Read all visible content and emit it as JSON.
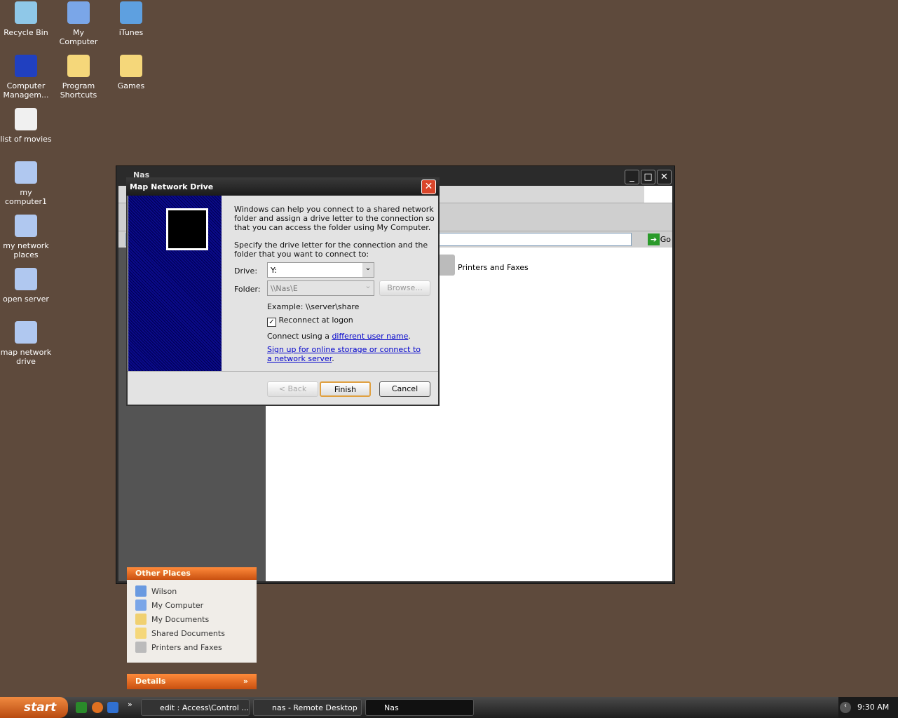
{
  "desktop": {
    "icons": [
      {
        "label": "Recycle Bin",
        "icon": "recycle-bin-icon",
        "color": "#8fc8e8"
      },
      {
        "label": "My Computer",
        "icon": "my-computer-icon",
        "color": "#7aa6e8"
      },
      {
        "label": "iTunes",
        "icon": "itunes-icon",
        "color": "#5ea0e0"
      },
      {
        "label": "Computer Managem...",
        "icon": "computer-management-icon",
        "color": "#2040c0"
      },
      {
        "label": "Program Shortcuts",
        "icon": "folder-icon",
        "color": "#f5d77a"
      },
      {
        "label": "Games",
        "icon": "folder-icon",
        "color": "#f5d77a"
      },
      {
        "label": "list of movies",
        "icon": "notepad-icon",
        "color": "#f0f0f0"
      },
      {
        "label": "my computer1",
        "icon": "shortcut-icon",
        "color": "#b0c8f0"
      },
      {
        "label": "my network places",
        "icon": "shortcut-icon",
        "color": "#b0c8f0"
      },
      {
        "label": "open server",
        "icon": "shortcut-icon",
        "color": "#b0c8f0"
      },
      {
        "label": "map network drive",
        "icon": "shortcut-icon",
        "color": "#b0c8f0"
      }
    ]
  },
  "explorer": {
    "title": "Nas",
    "go_label": "Go",
    "content_item": "Printers and Faxes",
    "other_places": {
      "title": "Other Places",
      "items": [
        "Wilson",
        "My Computer",
        "My Documents",
        "Shared Documents",
        "Printers and Faxes"
      ]
    },
    "details_title": "Details"
  },
  "dialog": {
    "title": "Map Network Drive",
    "intro": "Windows can help you connect to a shared network folder and assign a drive letter to the connection so that you can access the folder using My Computer.",
    "specify": "Specify the drive letter for the connection and the folder that you want to connect to:",
    "drive_label": "Drive:",
    "drive_value": "Y:",
    "folder_label": "Folder:",
    "folder_value": "\\\\Nas\\E",
    "browse": "Browse...",
    "example": "Example: \\\\server\\share",
    "reconnect": "Reconnect at logon",
    "reconnect_checked": true,
    "connect_prefix": "Connect using a ",
    "connect_link": "different user name",
    "signup_link": "Sign up for online storage or connect to a network server",
    "back": "< Back",
    "finish": "Finish",
    "cancel": "Cancel"
  },
  "taskbar": {
    "start": "start",
    "tasks": [
      "edit : Access\\Control ...",
      "nas - Remote Desktop",
      "Nas"
    ],
    "clock": "9:30 AM",
    "overflow": "»"
  }
}
